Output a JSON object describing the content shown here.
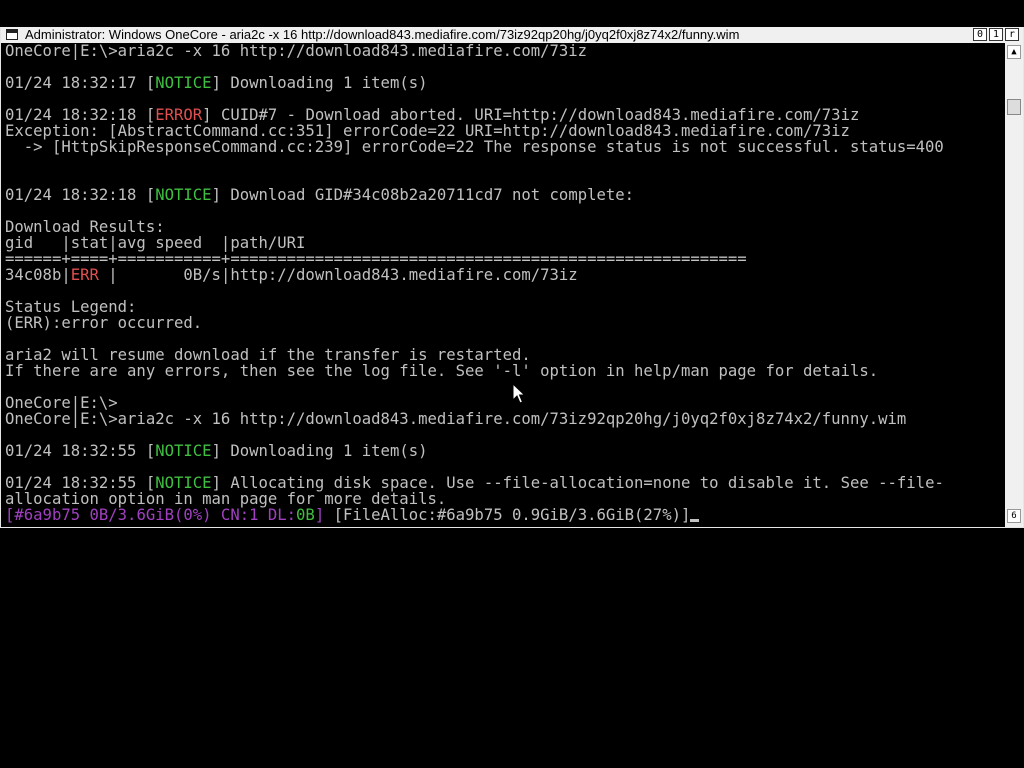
{
  "window": {
    "title": "Administrator:  Windows OneCore - aria2c  -x 16 http://download843.mediafire.com/73iz92qp20hg/j0yq2f0xj8z74x2/funny.wim",
    "buttons": [
      "0",
      "1",
      "r"
    ]
  },
  "scrollbar": {
    "up_glyph": "▲",
    "down_glyph": "6"
  },
  "console": {
    "line01": "OneCore|E:\\>aria2c -x 16 http://download843.mediafire.com/73iz",
    "line02": {
      "ts": "01/24 18:32:17 ",
      "tag": "NOTICE",
      "msg": " Downloading 1 item(s)"
    },
    "line03": {
      "ts": "01/24 18:32:18 ",
      "tag": "ERROR",
      "msg": " CUID#7 - Download aborted. URI=http://download843.mediafire.com/73iz"
    },
    "line04": "Exception: [AbstractCommand.cc:351] errorCode=22 URI=http://download843.mediafire.com/73iz",
    "line05": "  -> [HttpSkipResponseCommand.cc:239] errorCode=22 The response status is not successful. status=400",
    "line06": {
      "ts": "01/24 18:32:18 ",
      "tag": "NOTICE",
      "msg": " Download GID#34c08b2a20711cd7 not complete:"
    },
    "line07": "Download Results:",
    "line08": "gid   |stat|avg speed  |path/URI",
    "line09": "======+====+===========+=======================================================",
    "line10": {
      "gid": "34c08b|",
      "stat": "ERR ",
      "rest": "|       0B/s|http://download843.mediafire.com/73iz"
    },
    "line11": "Status Legend:",
    "line12": "(ERR):error occurred.",
    "line13": "aria2 will resume download if the transfer is restarted.",
    "line14": "If there are any errors, then see the log file. See '-l' option in help/man page for details.",
    "line15": "OneCore|E:\\>",
    "line16": "OneCore|E:\\>aria2c -x 16 http://download843.mediafire.com/73iz92qp20hg/j0yq2f0xj8z74x2/funny.wim",
    "line17": {
      "ts": "01/24 18:32:55 ",
      "tag": "NOTICE",
      "msg": " Downloading 1 item(s)"
    },
    "line18": {
      "ts": "01/24 18:32:55 ",
      "tag": "NOTICE",
      "msg": " Allocating disk space. Use --file-allocation=none to disable it. See --file-"
    },
    "line19": "allocation option in man page for more details.",
    "status": {
      "gid": "#6a9b75 0B/3.6GiB(0%) CN:1 DL:",
      "dl": "0B",
      "alloc": " [FileAlloc:#6a9b75 0.9GiB/3.6GiB(27%)]"
    }
  }
}
